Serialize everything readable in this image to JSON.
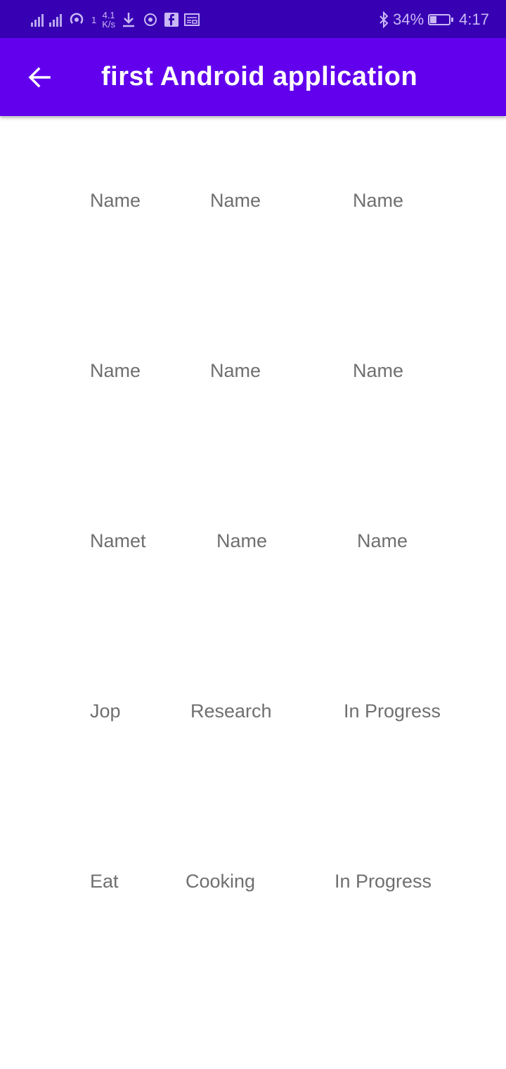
{
  "status_bar": {
    "network_speed_top": "4.1",
    "network_speed_bottom": "K/s",
    "sim_badge": "1",
    "battery": "34%",
    "battery_level": 0.34,
    "time": "4:17",
    "icons": [
      "no-signal-icon",
      "signal-icon",
      "hotspot-icon",
      "download-icon",
      "wifi-hotspot-icon",
      "facebook-icon",
      "news-icon",
      "bluetooth-icon",
      "battery-icon"
    ]
  },
  "app_bar": {
    "title": "first Android application",
    "back_icon": "arrow-left-icon",
    "color": "#6200ee"
  },
  "grid": {
    "rows": [
      [
        "Name",
        "Name",
        "Name"
      ],
      [
        "Name",
        "Name",
        "Name"
      ],
      [
        "Namet",
        "Name",
        "Name"
      ],
      [
        "Jop",
        "Research",
        "In Progress"
      ],
      [
        "Eat",
        "Cooking",
        "In Progress"
      ]
    ]
  }
}
